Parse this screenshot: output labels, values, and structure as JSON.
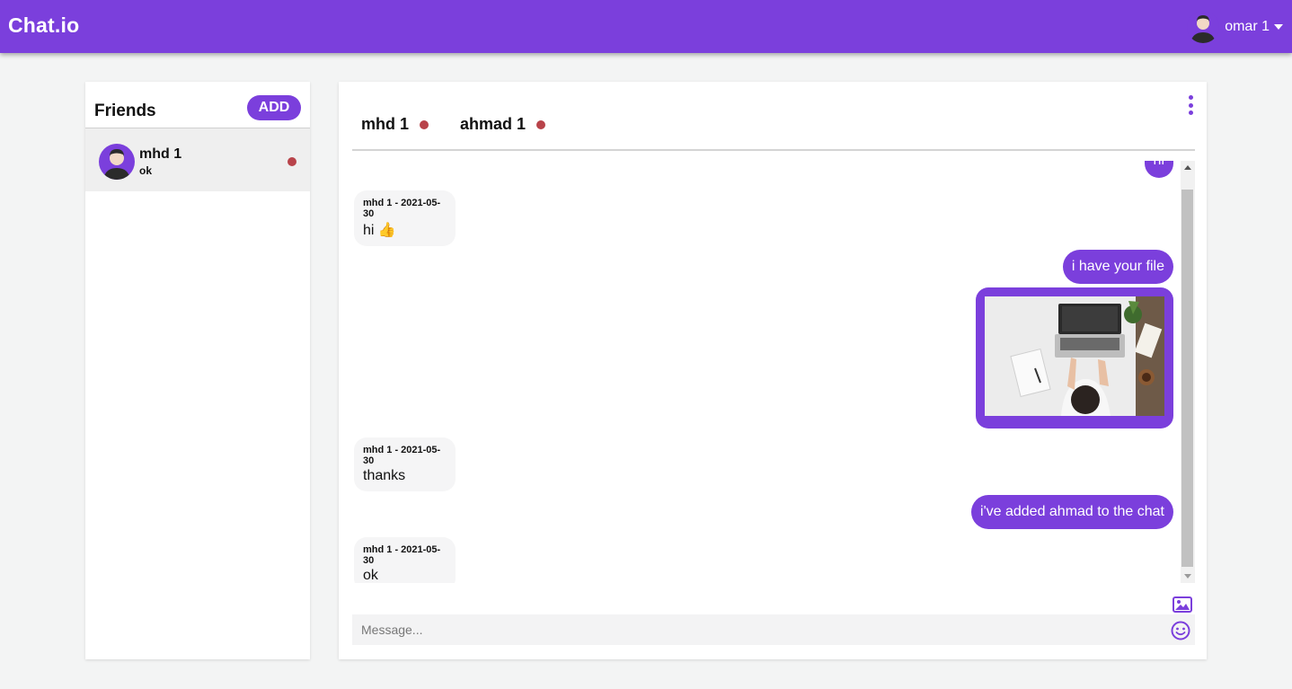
{
  "app": {
    "brand": "Chat.io"
  },
  "user": {
    "name": "omar 1"
  },
  "friends": {
    "title": "Friends",
    "add_label": "ADD",
    "items": [
      {
        "name": "mhd 1",
        "last_message": "ok",
        "status": "offline"
      }
    ]
  },
  "chat": {
    "members": [
      {
        "name": "mhd 1",
        "status": "offline"
      },
      {
        "name": "ahmad 1",
        "status": "offline"
      }
    ],
    "messages": [
      {
        "from": "self",
        "type": "text",
        "text": "hi"
      },
      {
        "from": "other",
        "type": "text",
        "meta": "mhd 1 - 2021-05-30",
        "text": "hi 👍"
      },
      {
        "from": "self",
        "type": "text",
        "text": "i have your file"
      },
      {
        "from": "self",
        "type": "image"
      },
      {
        "from": "other",
        "type": "text",
        "meta": "mhd 1 - 2021-05-30",
        "text": "thanks"
      },
      {
        "from": "self",
        "type": "text",
        "text": "i've added ahmad to the chat"
      },
      {
        "from": "other",
        "type": "text",
        "meta": "mhd 1 - 2021-05-30",
        "text": "ok"
      }
    ],
    "composer_placeholder": "Message..."
  },
  "colors": {
    "accent": "#7b3fdc",
    "status_offline": "#b8434a",
    "background": "#f3f4f4"
  },
  "icons": [
    "user-avatar-icon",
    "caret-down-icon",
    "more-vert-icon",
    "image-icon",
    "emoji-icon"
  ]
}
